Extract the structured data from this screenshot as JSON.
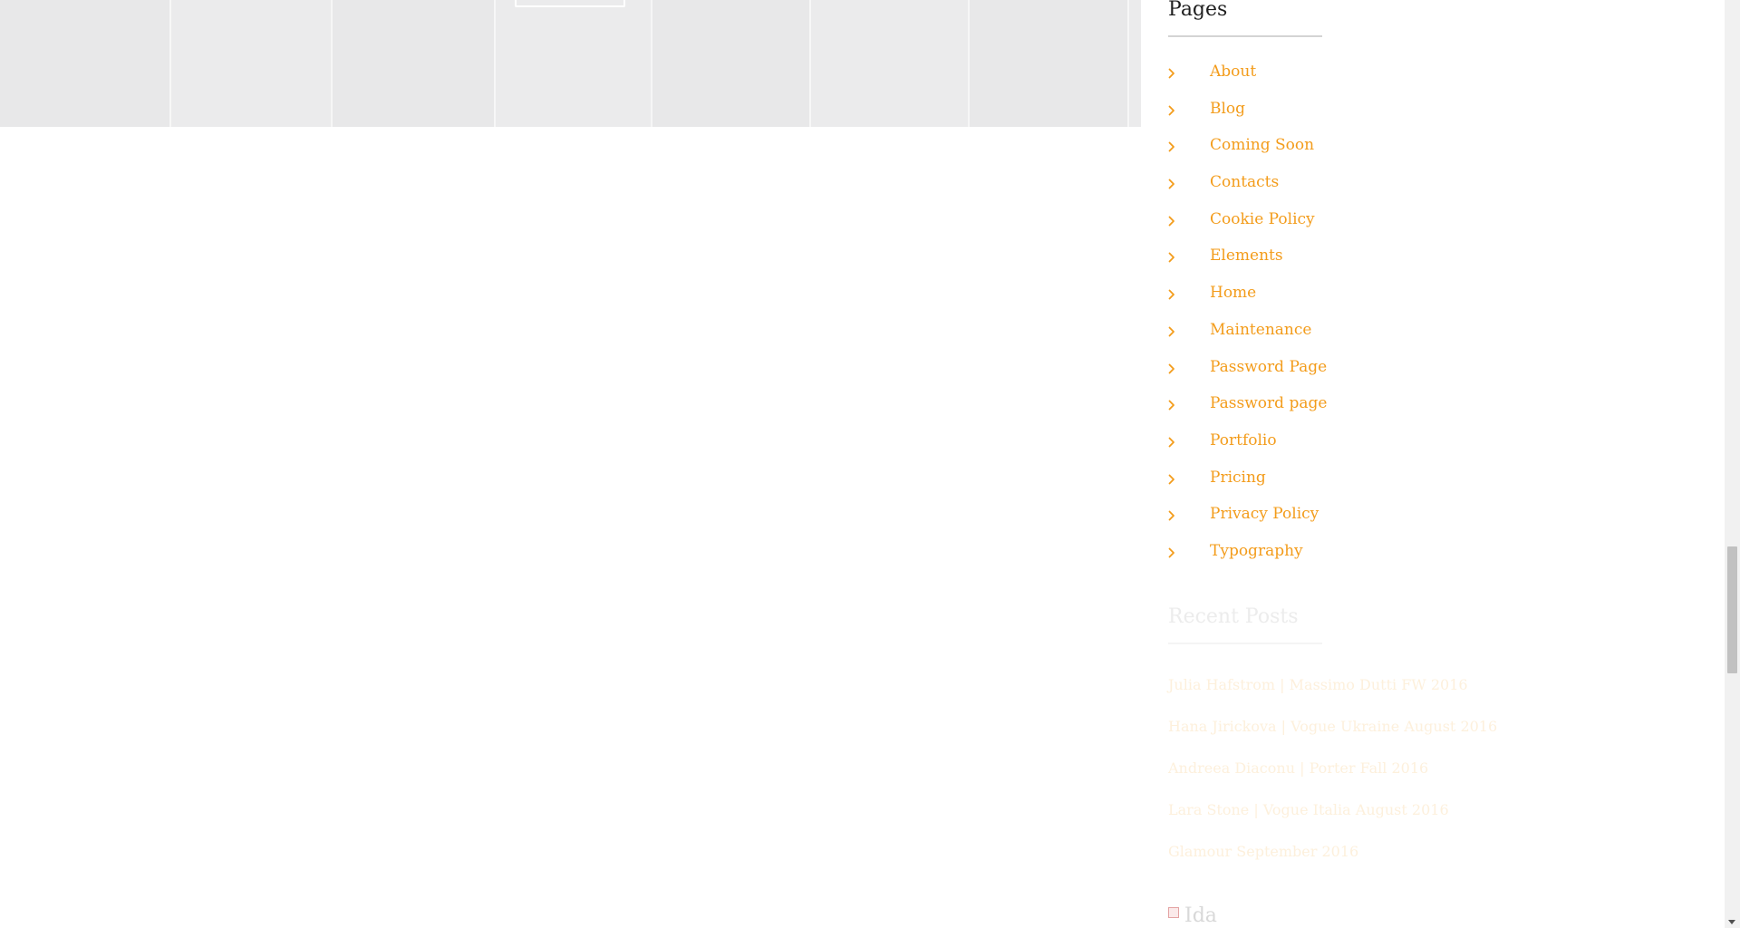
{
  "hero": {
    "button_label": ""
  },
  "sidebar": {
    "pages_widget": {
      "title": "Pages",
      "items": [
        {
          "label": "About",
          "icon": "chevron-right-icon"
        },
        {
          "label": "Blog",
          "icon": "chevron-right-icon"
        },
        {
          "label": "Coming Soon",
          "icon": "chevron-right-icon"
        },
        {
          "label": "Contacts",
          "icon": "chevron-right-icon"
        },
        {
          "label": "Cookie Policy",
          "icon": "chevron-right-icon"
        },
        {
          "label": "Elements",
          "icon": "chevron-right-icon"
        },
        {
          "label": "Home",
          "icon": "chevron-right-icon"
        },
        {
          "label": "Maintenance",
          "icon": "chevron-right-icon"
        },
        {
          "label": "Password Page",
          "icon": "chevron-right-icon"
        },
        {
          "label": "Password page",
          "icon": "chevron-right-icon"
        },
        {
          "label": "Portfolio",
          "icon": "chevron-right-icon"
        },
        {
          "label": "Pricing",
          "icon": "chevron-right-icon"
        },
        {
          "label": "Privacy Policy",
          "icon": "chevron-right-icon"
        },
        {
          "label": "Typography",
          "icon": "chevron-right-icon"
        }
      ]
    },
    "recent_posts_widget": {
      "title": "Recent Posts",
      "items": [
        {
          "label": "Julia Hafstrom | Massimo Dutti FW 2016"
        },
        {
          "label": "Hana Jirickova | Vogue Ukraine August 2016"
        },
        {
          "label": "Andreea Diaconu | Porter Fall 2016"
        },
        {
          "label": "Lara Stone | Vogue Italia August 2016"
        },
        {
          "label": "Glamour September 2016"
        }
      ]
    },
    "instagram_widget": {
      "title": "Ida"
    }
  },
  "colors": {
    "link_accent": "#f39c1b",
    "faded_link": "#fdf0dc",
    "title": "#1f1f1f",
    "hero_background": "#ebebec"
  }
}
